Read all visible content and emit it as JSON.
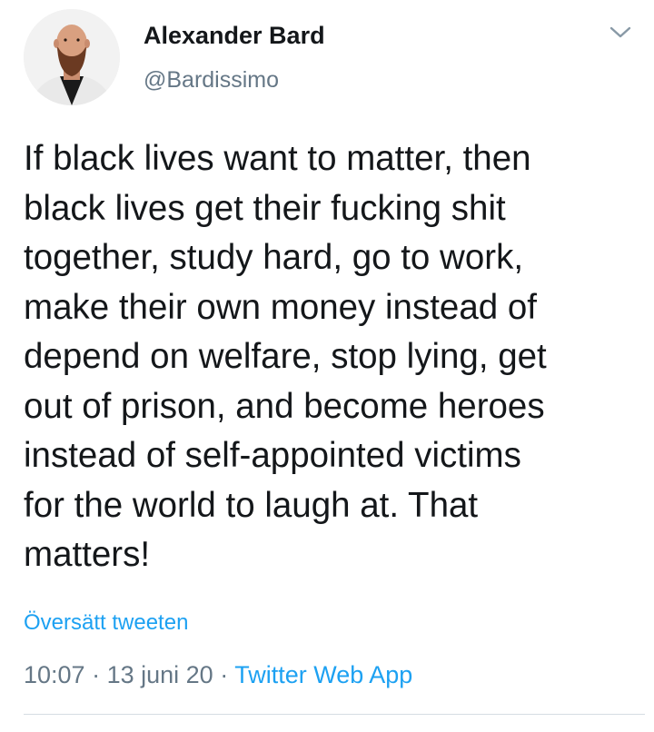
{
  "author": {
    "display_name": "Alexander Bard",
    "handle": "@Bardissimo"
  },
  "tweet": {
    "text": "If black lives want to matter, then\nblack lives get their fucking shit\ntogether, study hard, go to work,\nmake their own money instead of\ndepend on welfare, stop lying, get\nout of prison, and become heroes\ninstead of self-appointed victims\nfor the world to laugh at. That\nmatters!",
    "translate_label": "Översätt tweeten",
    "time": "10:07",
    "separator": " · ",
    "date": "13 juni 20",
    "source": "Twitter Web App"
  },
  "icons": {
    "menu": "chevron-down-icon",
    "avatar": "avatar"
  },
  "colors": {
    "link": "#1da1f2",
    "secondary_text": "#657786",
    "primary_text": "#14171a"
  }
}
